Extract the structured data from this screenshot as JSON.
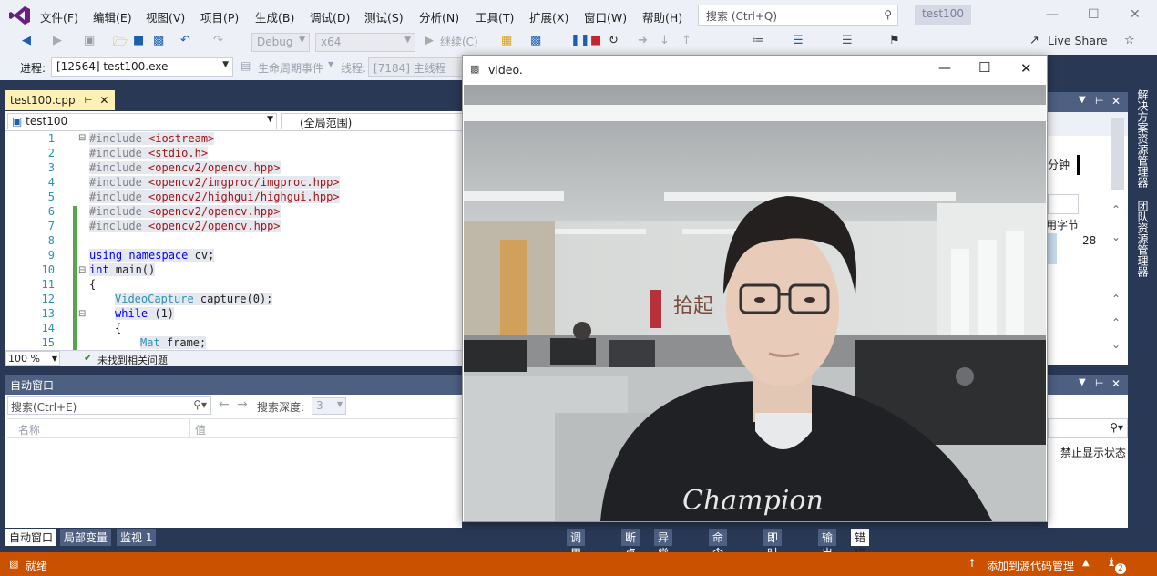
{
  "menubar": {
    "items": [
      "文件(F)",
      "编辑(E)",
      "视图(V)",
      "项目(P)",
      "生成(B)",
      "调试(D)",
      "测试(S)",
      "分析(N)",
      "工具(T)",
      "扩展(X)",
      "窗口(W)",
      "帮助(H)"
    ],
    "search_placeholder": "搜索 (Ctrl+Q)",
    "solution_name": "test100"
  },
  "toolbar": {
    "config": "Debug",
    "platform": "x64",
    "continue_label": "继续(C)",
    "live_share": "Live Share"
  },
  "toolbar2": {
    "process_label": "进程:",
    "process_value": "[12564] test100.exe",
    "lifecycle_label": "生命周期事件",
    "thread_label": "线程:",
    "thread_value": "[7184] 主线程"
  },
  "editor": {
    "tab_name": "test100.cpp",
    "scope_left": "test100",
    "scope_right": "(全局范围)",
    "zoom": "100 %",
    "issues": "未找到相关问题",
    "line_numbers": [
      "1",
      "2",
      "3",
      "4",
      "5",
      "6",
      "7",
      "8",
      "9",
      "10",
      "11",
      "12",
      "13",
      "14",
      "15"
    ]
  },
  "auto_window": {
    "title": "自动窗口",
    "search_placeholder": "搜索(Ctrl+E)",
    "depth_label": "搜索深度:",
    "depth_value": "3",
    "col_name": "名称",
    "col_value": "值"
  },
  "bottom_tabs_left": [
    "自动窗口",
    "局部变量",
    "监视 1"
  ],
  "bottom_tabs_right": [
    "调用堆栈",
    "断点",
    "异常设置",
    "命令窗口",
    "即时窗口",
    "输出",
    "错误列表"
  ],
  "right_panel": {
    "fragments": [
      "分钟",
      "用字节",
      "28",
      "禁止显示状态"
    ]
  },
  "right_side_tabs": [
    "解决方案资源管理器",
    "团队资源管理器"
  ],
  "statusbar": {
    "status": "就绪",
    "source_control": "添加到源代码管理",
    "notifications": "2"
  },
  "video_window": {
    "title": "video."
  },
  "colors": {
    "vs_dark": "#293955",
    "status_orange": "#ca5100",
    "vs_accent": "#68217a"
  }
}
